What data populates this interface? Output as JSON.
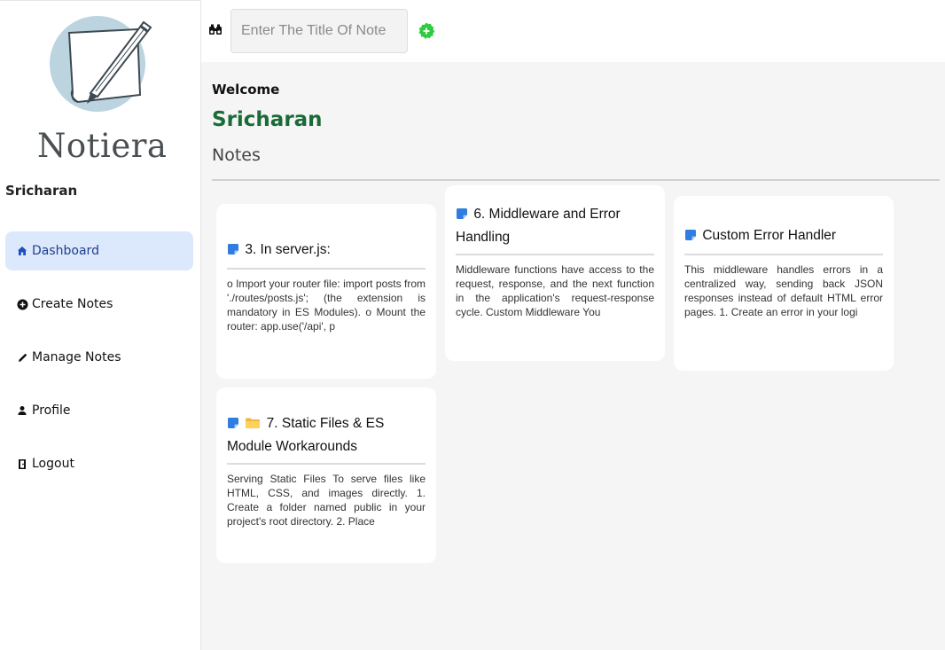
{
  "app": {
    "name": "Notiera"
  },
  "sidebar": {
    "username": "Sricharan",
    "items": [
      {
        "label": "Dashboard",
        "icon": "home-icon",
        "active": true
      },
      {
        "label": "Create Notes",
        "icon": "plus-circle-icon",
        "active": false
      },
      {
        "label": "Manage Notes",
        "icon": "pencil-icon",
        "active": false
      },
      {
        "label": "Profile",
        "icon": "user-icon",
        "active": false
      },
      {
        "label": "Logout",
        "icon": "logout-icon",
        "active": false
      }
    ]
  },
  "topbar": {
    "search_placeholder": "Enter The Title Of Note",
    "search_value": "",
    "search_icon": "binoculars-icon",
    "add_icon": "add-circle-icon"
  },
  "main": {
    "welcome": "Welcome",
    "user_name": "Sricharan",
    "section_title": "Notes",
    "notes": [
      {
        "title": "3. In server.js:",
        "body": "o Import your router file: import posts from './routes/posts.js'; (the extension is mandatory in ES Modules). o Mount the router: app.use('/api', p"
      },
      {
        "title": "6. Middleware and Error Handling",
        "body": "Middleware functions have access to the request, response, and the next function in the application's request-response cycle. Custom Middleware You"
      },
      {
        "title": "Custom Error Handler",
        "body": "This middleware handles errors in a centralized way, sending back JSON responses instead of default HTML error pages. 1. Create an error in your logi"
      },
      {
        "title": "7. Static Files & ES Module Workarounds",
        "body": "Serving Static Files To serve files like HTML, CSS, and images directly. 1. Create a folder named public in your project's root directory. 2. Place"
      }
    ]
  },
  "colors": {
    "accent_green": "#1a6b38",
    "active_nav_bg": "#dce8fb",
    "note_icon_blue": "#2f7de1",
    "add_button_green": "#2ecc40"
  }
}
